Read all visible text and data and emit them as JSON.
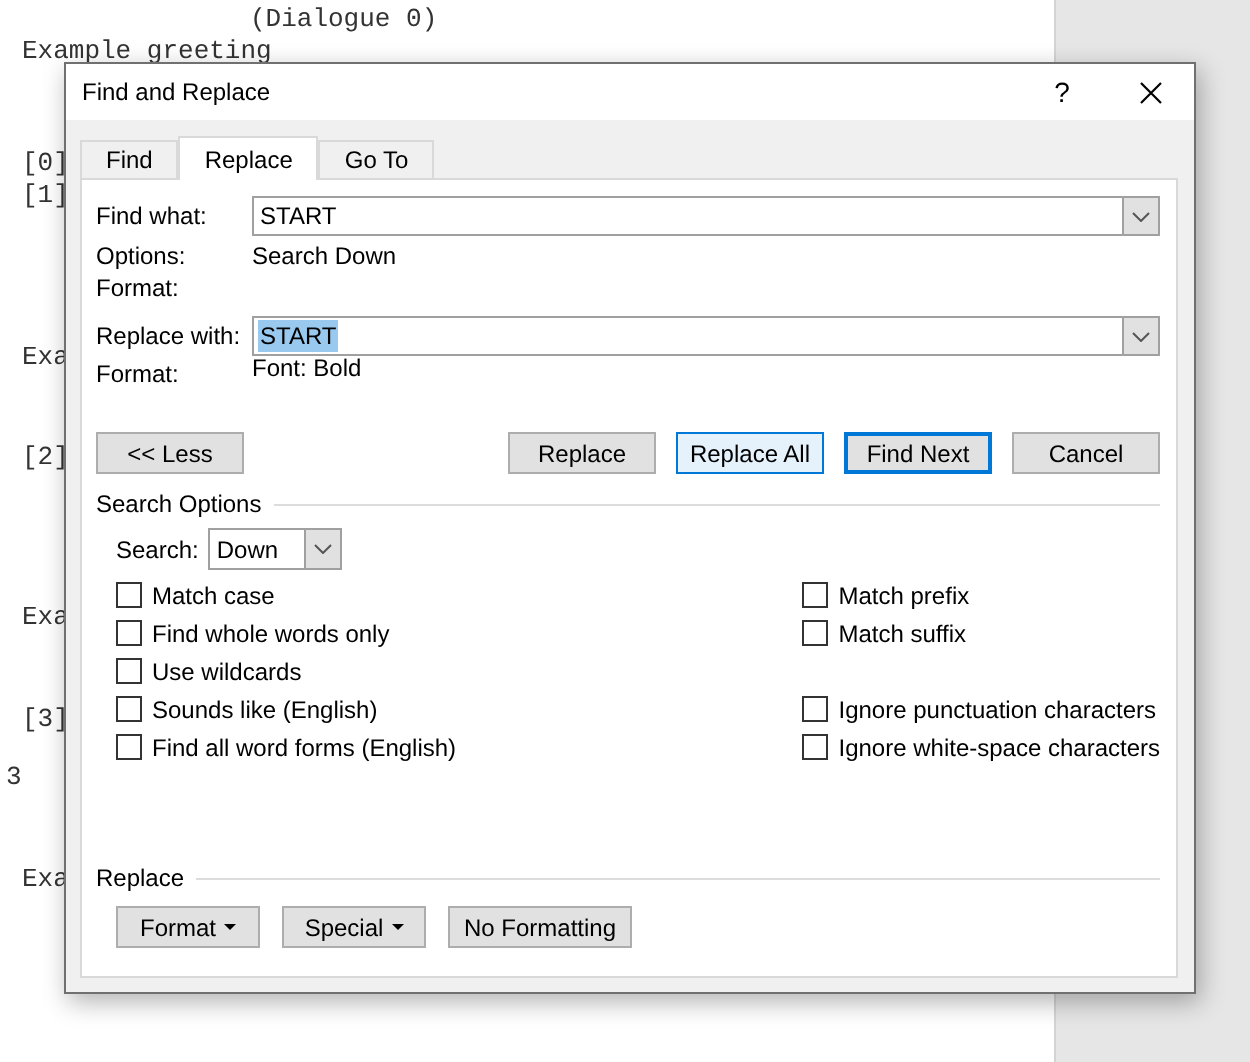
{
  "document": {
    "lines": [
      "(Dialogue 0)",
      "Example greeting",
      "[0]",
      "[1]",
      "Exa",
      "[2]",
      "Exa",
      "[3]",
      "3",
      "Exa"
    ]
  },
  "dialog": {
    "title": "Find and Replace",
    "help": "?",
    "tabs": [
      {
        "label": "Find",
        "selected": false
      },
      {
        "label": "Replace",
        "selected": true
      },
      {
        "label": "Go To",
        "selected": false
      }
    ],
    "find_what": {
      "label": "Find what:",
      "value": "START"
    },
    "find_options": {
      "label": "Options:",
      "value": "Search Down"
    },
    "find_format": {
      "label": "Format:"
    },
    "replace_with": {
      "label": "Replace with:",
      "value": "START",
      "selected_text": true
    },
    "replace_format": {
      "label": "Format:",
      "value": "Font: Bold"
    },
    "less_button": "<< Less",
    "action_buttons": [
      {
        "label": "Replace",
        "kind": "normal"
      },
      {
        "label": "Replace All",
        "kind": "hover"
      },
      {
        "label": "Find Next",
        "kind": "default"
      },
      {
        "label": "Cancel",
        "kind": "normal"
      }
    ],
    "search_options": {
      "title": "Search Options",
      "search_label": "Search:",
      "search_value": "Down",
      "left_options": [
        {
          "label": "Match case",
          "checked": false
        },
        {
          "label": "Find whole words only",
          "checked": false
        },
        {
          "label": "Use wildcards",
          "checked": false
        },
        {
          "label": "Sounds like (English)",
          "checked": false
        },
        {
          "label": "Find all word forms (English)",
          "checked": false
        }
      ],
      "right_option_groups": [
        [
          {
            "label": "Match prefix",
            "checked": false
          },
          {
            "label": "Match suffix",
            "checked": false
          }
        ],
        [
          {
            "label": "Ignore punctuation characters",
            "checked": false
          },
          {
            "label": "Ignore white-space characters",
            "checked": false
          }
        ]
      ]
    },
    "replace_section": {
      "title": "Replace",
      "buttons": [
        {
          "label": "Format",
          "kind": "menu"
        },
        {
          "label": "Special",
          "kind": "menu"
        },
        {
          "label": "No Formatting",
          "kind": "plain"
        }
      ]
    }
  }
}
